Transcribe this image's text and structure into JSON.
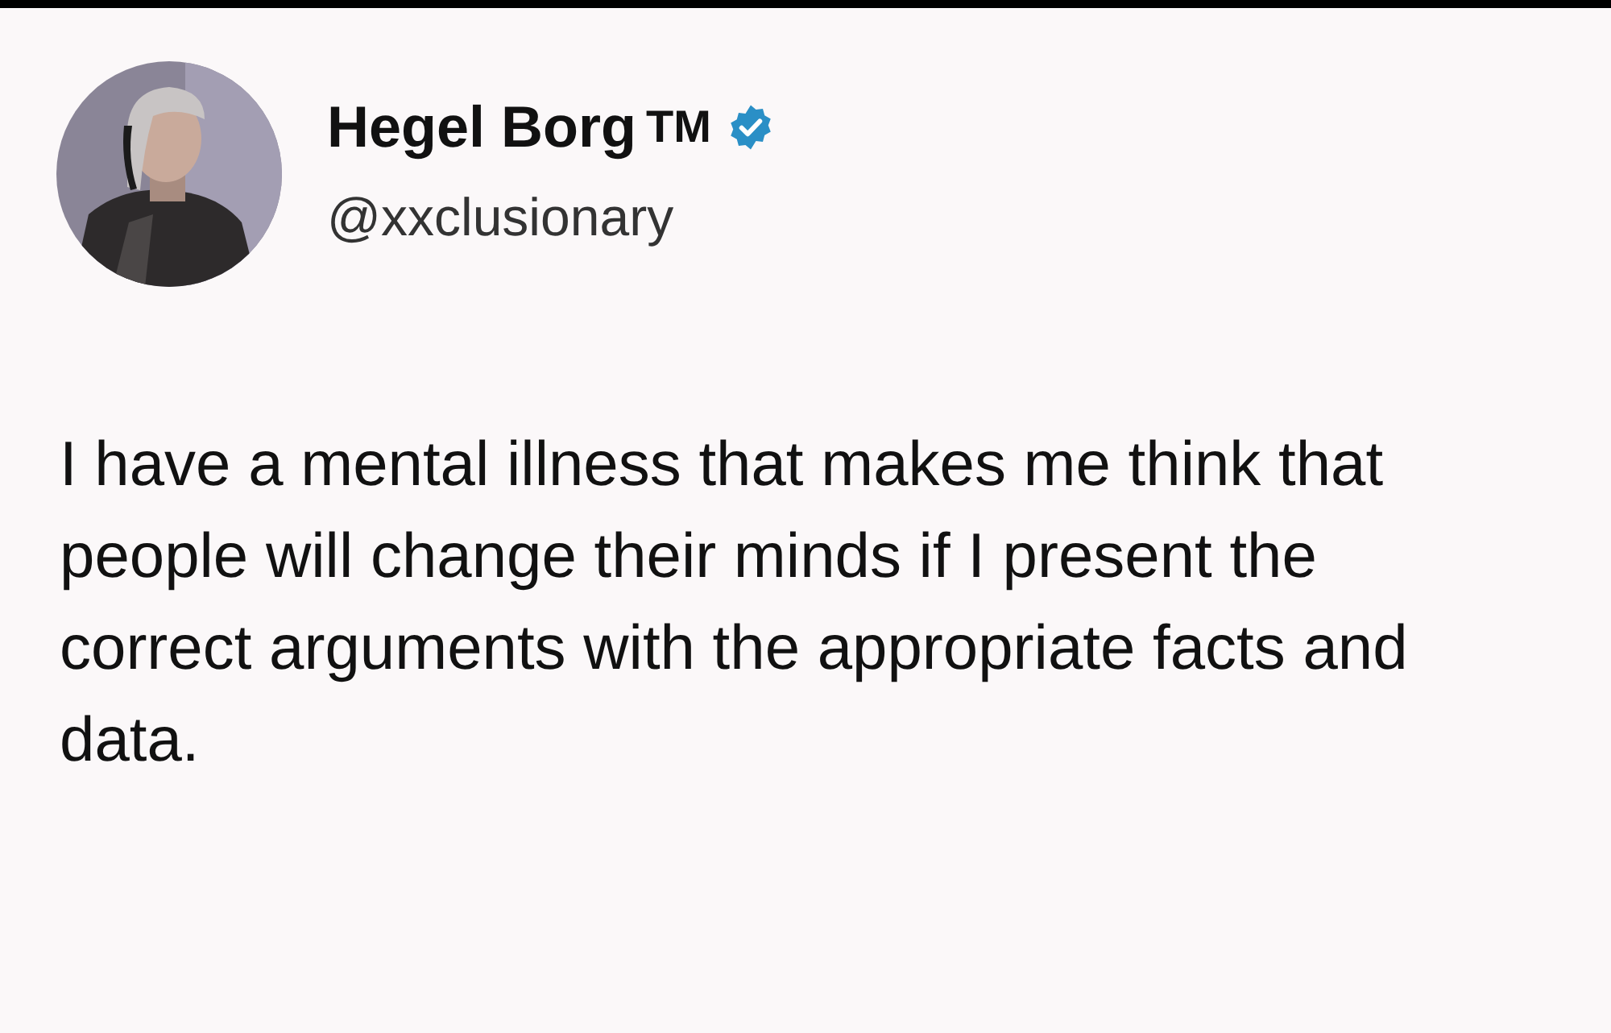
{
  "author": {
    "name": "Hegel Borg",
    "trademark": "TM",
    "verified": true,
    "handle": "@xxclusionary"
  },
  "post": {
    "text": "I have a mental illness that makes me think that people will change their minds if I present the correct arguments with the appropriate facts and data."
  }
}
